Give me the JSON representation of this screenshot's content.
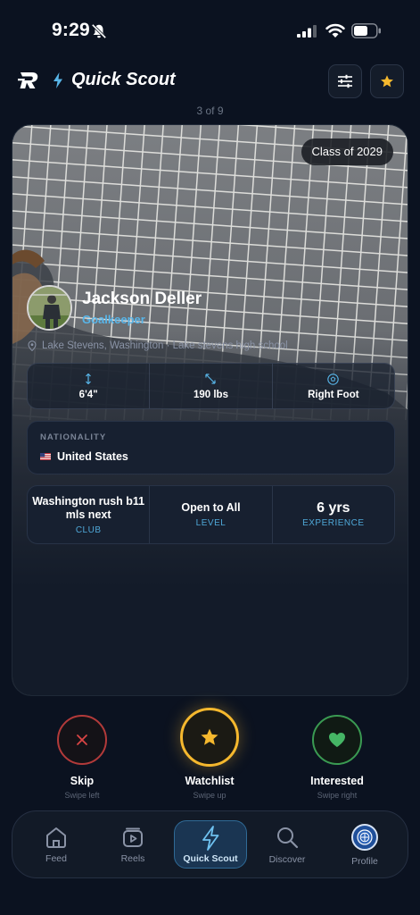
{
  "status": {
    "time": "9:29"
  },
  "header": {
    "title": "Quick Scout",
    "counter": "3 of 9"
  },
  "player": {
    "class_badge": "Class of 2029",
    "name": "Jackson Deller",
    "position": "Goalkeeper",
    "location": "Lake Stevens, Washington · Lake stevens high school",
    "height": "6'4\"",
    "weight": "190 lbs",
    "foot": "Right Foot",
    "nationality_label": "NATIONALITY",
    "nationality": "United States",
    "club": "Washington rush b11 mls next",
    "club_label": "CLUB",
    "level": "Open to All",
    "level_label": "LEVEL",
    "experience": "6 yrs",
    "experience_label": "EXPERIENCE"
  },
  "actions": {
    "skip": {
      "label": "Skip",
      "hint": "Swipe left",
      "color": "#b23a3a"
    },
    "watchlist": {
      "label": "Watchlist",
      "hint": "Swipe up",
      "color": "#f5b82e"
    },
    "interested": {
      "label": "Interested",
      "hint": "Swipe right",
      "color": "#3a9a52"
    }
  },
  "nav": {
    "items": [
      {
        "label": "Feed",
        "icon": "home-icon"
      },
      {
        "label": "Reels",
        "icon": "reels-icon"
      },
      {
        "label": "Quick Scout",
        "icon": "bolt-icon"
      },
      {
        "label": "Discover",
        "icon": "search-icon"
      },
      {
        "label": "Profile",
        "icon": "profile-avatar"
      }
    ],
    "active": "Quick Scout"
  },
  "colors": {
    "accent": "#58b5e8",
    "background": "#0b1220"
  }
}
